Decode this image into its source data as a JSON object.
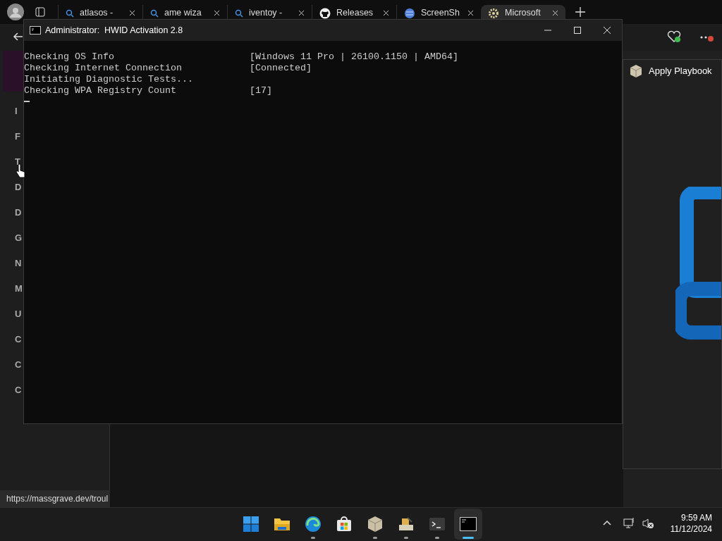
{
  "browser": {
    "tabs": [
      {
        "label": "atlasos -",
        "kind": "search",
        "selected": false
      },
      {
        "label": "ame wiza",
        "kind": "search",
        "selected": false
      },
      {
        "label": "iventoy -",
        "kind": "search",
        "selected": false
      },
      {
        "label": "Releases",
        "kind": "github",
        "selected": false
      },
      {
        "label": "ScreenSh",
        "kind": "globe",
        "selected": false
      },
      {
        "label": "Microsoft",
        "kind": "settings",
        "selected": true
      }
    ],
    "sidebar_items": [
      "I",
      "F",
      "T",
      "D",
      "D",
      "G",
      "N",
      "M",
      "U",
      "C",
      "C",
      "C"
    ],
    "status_url": "https://massgrave.dev/troul"
  },
  "console": {
    "title": "Administrator:  HWID Activation 2.8",
    "lines": [
      {
        "label": "Checking OS Info",
        "value": "[Windows 11 Pro | 26100.1150 | AMD64]"
      },
      {
        "label": "Checking Internet Connection",
        "value": "[Connected]"
      },
      {
        "label": "Initiating Diagnostic Tests..."
      },
      {
        "label": "Checking WPA Registry Count",
        "value": "[17]"
      }
    ]
  },
  "playbook": {
    "title": "Apply Playbook"
  },
  "taskbar": {
    "apps": [
      {
        "kind": "start",
        "running": false,
        "selected": false
      },
      {
        "kind": "folder",
        "running": false,
        "selected": false
      },
      {
        "kind": "edge",
        "running": true,
        "selected": false
      },
      {
        "kind": "store",
        "running": false,
        "selected": false
      },
      {
        "kind": "box",
        "running": true,
        "selected": false
      },
      {
        "kind": "installer",
        "running": true,
        "selected": false
      },
      {
        "kind": "terminal",
        "running": true,
        "selected": false
      },
      {
        "kind": "console",
        "running": true,
        "selected": true
      }
    ],
    "time": "9:59 AM",
    "date": "11/12/2024"
  }
}
